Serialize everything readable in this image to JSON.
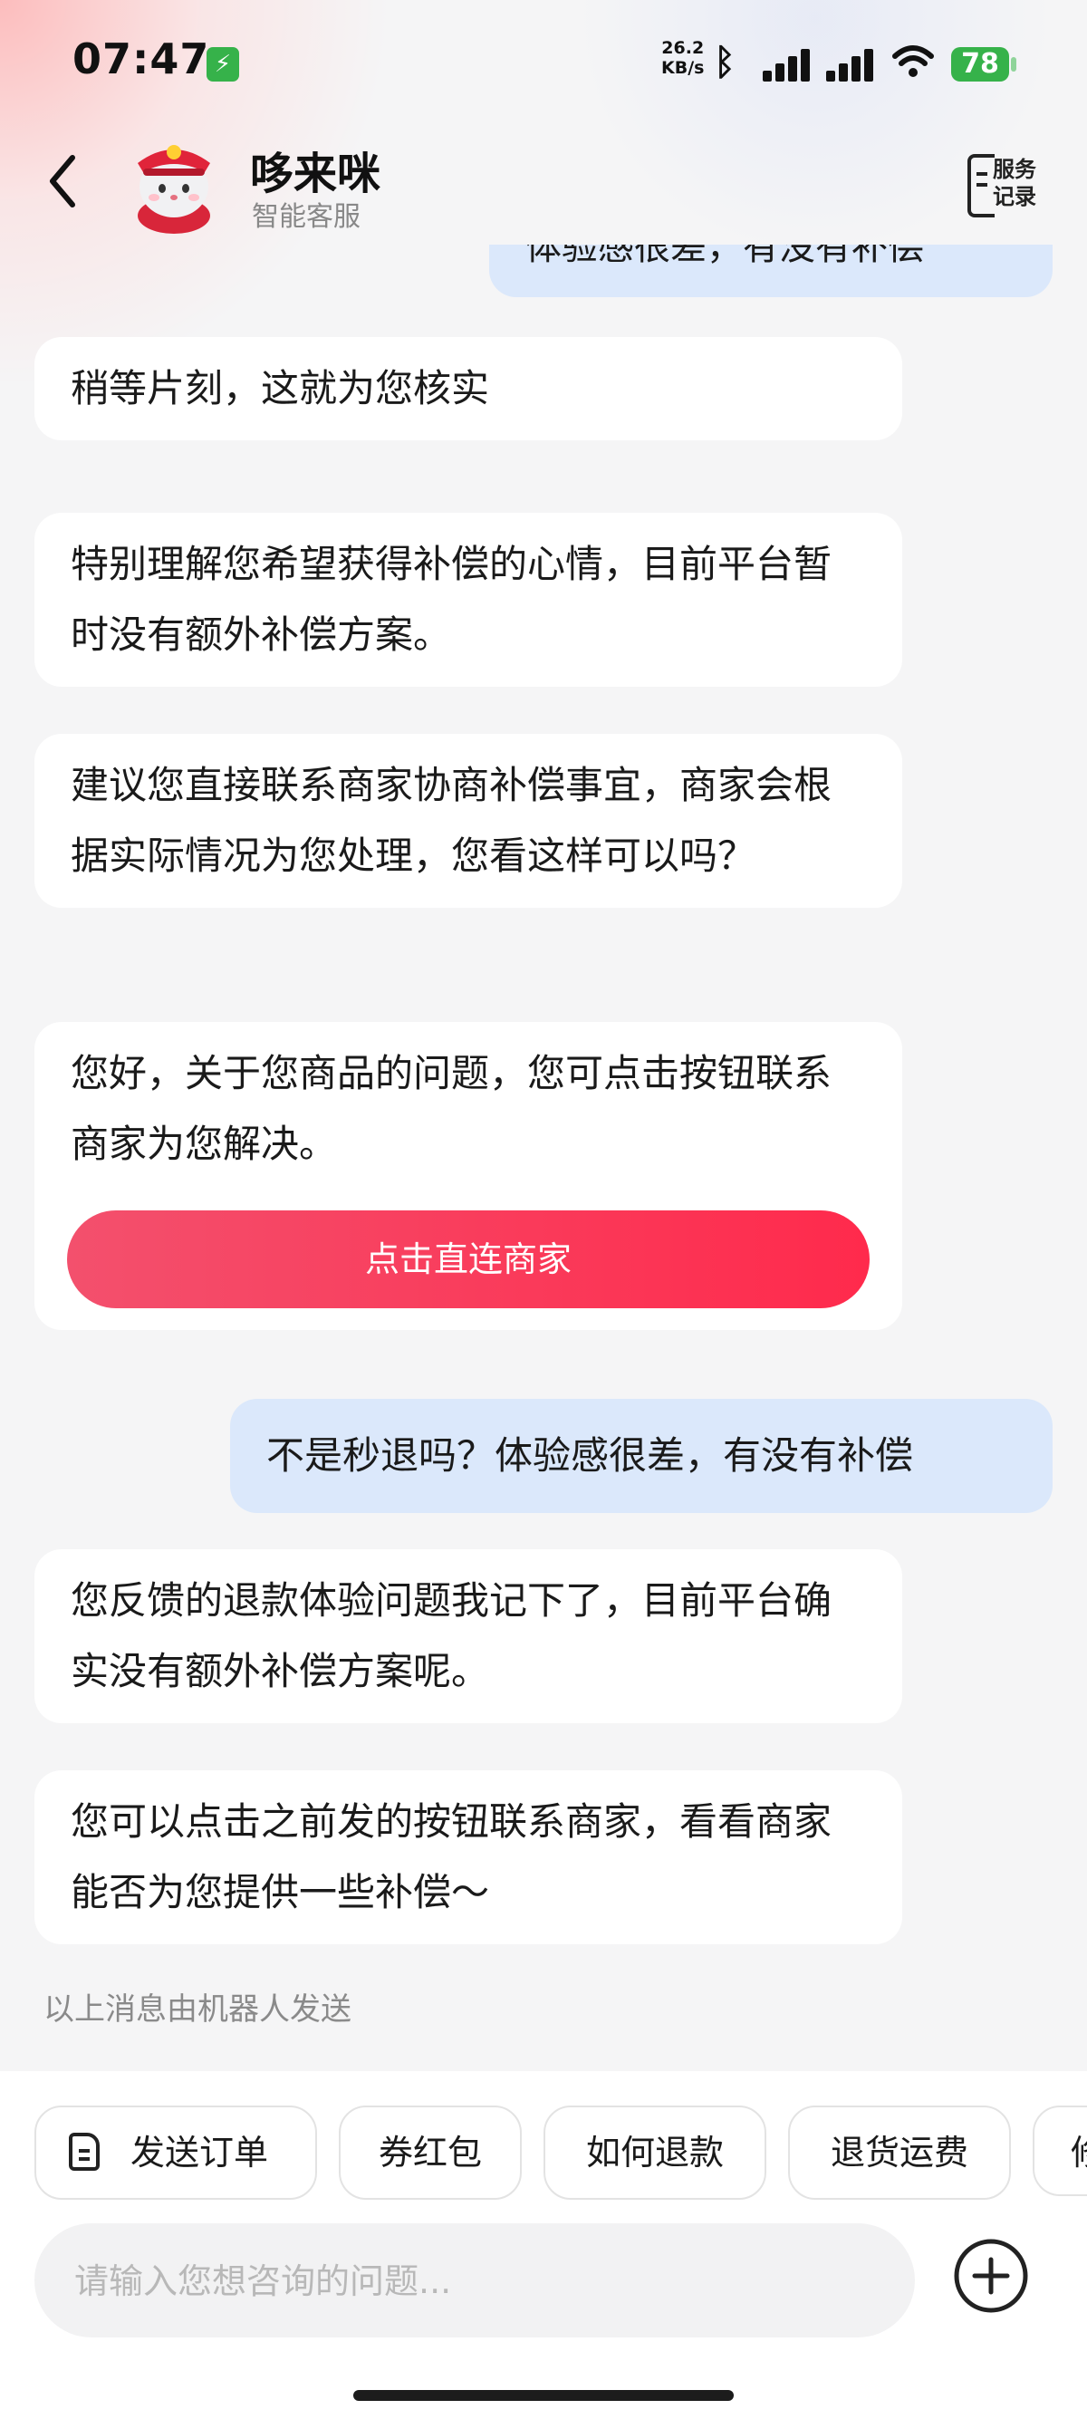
{
  "status_bar": {
    "time": "07:47",
    "charge_badge": "⚡",
    "net_speed_value": "26.2",
    "net_speed_unit": "KB/s",
    "battery": "78"
  },
  "header": {
    "agent_name": "哆来咪",
    "agent_subtitle": "智能客服",
    "records_line1": "服务",
    "records_line2": "记录"
  },
  "messages": [
    {
      "role": "user",
      "text": "体验感很差，有没有补偿"
    },
    {
      "role": "bot",
      "text": "稍等片刻，这就为您核实"
    },
    {
      "role": "bot",
      "text": "特别理解您希望获得补偿的心情，目前平台暂时没有额外补偿方案。"
    },
    {
      "role": "bot",
      "text": "建议您直接联系商家协商补偿事宜，商家会根据实际情况为您处理，您看这样可以吗？"
    },
    {
      "role": "bot",
      "text": "您好，关于您商品的问题，您可点击按钮联系商家为您解决。",
      "button": "点击直连商家"
    },
    {
      "role": "user",
      "text": "不是秒退吗？体验感很差，有没有补偿"
    },
    {
      "role": "bot",
      "text": "您反馈的退款体验问题我记下了，目前平台确实没有额外补偿方案呢。"
    },
    {
      "role": "bot",
      "text": "您可以点击之前发的按钮联系商家，看看商家能否为您提供一些补偿～"
    }
  ],
  "robot_note": "以上消息由机器人发送",
  "quick_actions": [
    "发送订单",
    "券红包",
    "如何退款",
    "退货运费",
    "修"
  ],
  "input": {
    "placeholder": "请输入您想咨询的问题..."
  },
  "colors": {
    "accent": "#ff2a4c",
    "user_bubble": "#dbe8fb",
    "battery": "#36b24a"
  },
  "icons": {
    "back": "chevron-left-icon",
    "records": "service-records-icon",
    "plus": "plus-circle-icon",
    "order": "document-icon"
  }
}
